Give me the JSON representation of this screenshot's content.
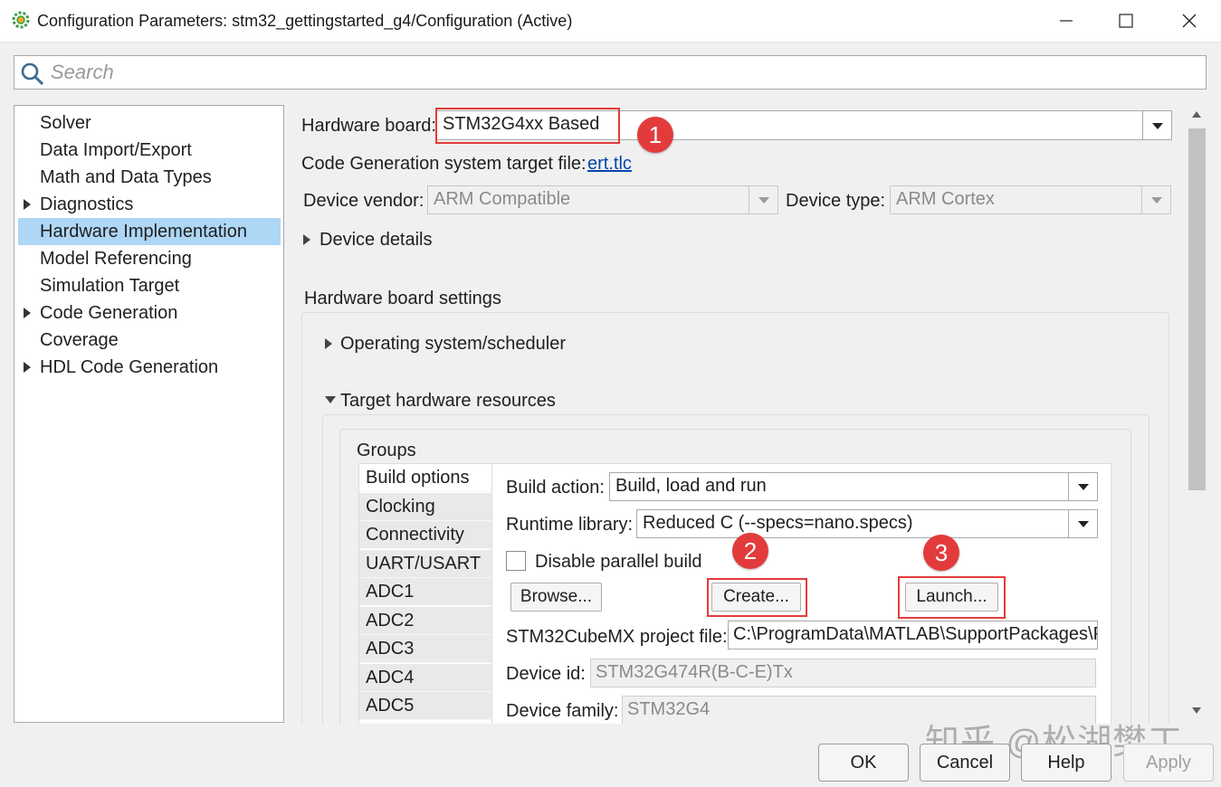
{
  "window": {
    "title": "Configuration Parameters: stm32_gettingstarted_g4/Configuration (Active)",
    "minimize": "—",
    "maximize": "☐",
    "close": "✕"
  },
  "search": {
    "placeholder": "Search",
    "value": ""
  },
  "tree": {
    "items": [
      {
        "label": "Solver",
        "expandable": false,
        "selected": false
      },
      {
        "label": "Data Import/Export",
        "expandable": false,
        "selected": false
      },
      {
        "label": "Math and Data Types",
        "expandable": false,
        "selected": false
      },
      {
        "label": "Diagnostics",
        "expandable": true,
        "selected": false
      },
      {
        "label": "Hardware Implementation",
        "expandable": false,
        "selected": true
      },
      {
        "label": "Model Referencing",
        "expandable": false,
        "selected": false
      },
      {
        "label": "Simulation Target",
        "expandable": false,
        "selected": false
      },
      {
        "label": "Code Generation",
        "expandable": true,
        "selected": false
      },
      {
        "label": "Coverage",
        "expandable": false,
        "selected": false
      },
      {
        "label": "HDL Code Generation",
        "expandable": true,
        "selected": false
      }
    ]
  },
  "hardware": {
    "board_label": "Hardware board:",
    "board_value": "STM32G4xx Based",
    "target_file_label": "Code Generation system target file:",
    "target_file_link": "ert.tlc",
    "vendor_label": "Device vendor:",
    "vendor_value": "ARM Compatible",
    "type_label": "Device type:",
    "type_value": "ARM Cortex",
    "device_details": "Device details",
    "board_settings": "Hardware board settings",
    "os_scheduler": "Operating system/scheduler",
    "target_resources": "Target hardware resources",
    "groups_label": "Groups",
    "groups": [
      "Build options",
      "Clocking",
      "Connectivity",
      "UART/USART",
      "ADC1",
      "ADC2",
      "ADC3",
      "ADC4",
      "ADC5"
    ],
    "build_action_label": "Build action:",
    "build_action_value": "Build, load and run",
    "runtime_label": "Runtime library:",
    "runtime_value": "Reduced C (--specs=nano.specs)",
    "disable_parallel": "Disable parallel build",
    "disable_parallel_checked": false,
    "browse": "Browse...",
    "create": "Create...",
    "launch": "Launch...",
    "cubemx_label": "STM32CubeMX project file:",
    "cubemx_value": "C:\\ProgramData\\MATLAB\\SupportPackages\\F",
    "device_id_label": "Device id:",
    "device_id_value": "STM32G474R(B-C-E)Tx",
    "device_family_label": "Device family:",
    "device_family_value": "STM32G4"
  },
  "annotations": {
    "b1": "1",
    "b2": "2",
    "b3": "3",
    "color": "#e33b3b"
  },
  "footer": {
    "ok": "OK",
    "cancel": "Cancel",
    "help": "Help",
    "apply": "Apply"
  },
  "watermark": "知乎 @松湖樊工",
  "colors": {
    "selection": "#aed6f5",
    "link": "#0645ad",
    "badge": "#e33b3b"
  }
}
